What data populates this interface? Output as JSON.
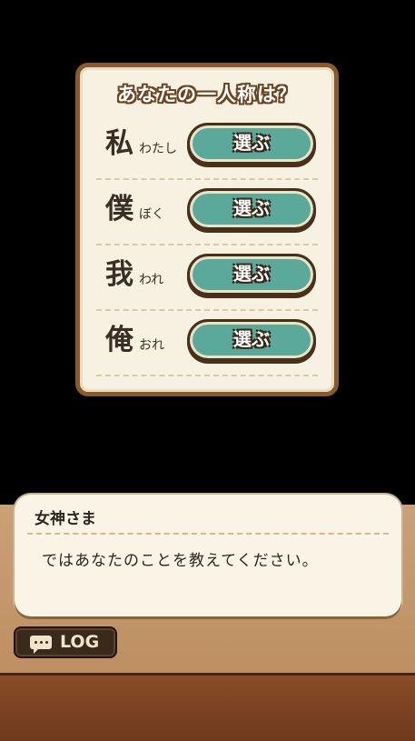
{
  "panel": {
    "title": "あなたの一人称は？",
    "choices": [
      {
        "kanji": "私",
        "reading": "わたし",
        "button": "選ぶ"
      },
      {
        "kanji": "僕",
        "reading": "ぼく",
        "button": "選ぶ"
      },
      {
        "kanji": "我",
        "reading": "われ",
        "button": "選ぶ"
      },
      {
        "kanji": "俺",
        "reading": "おれ",
        "button": "選ぶ"
      }
    ]
  },
  "dialog": {
    "speaker": "女神さま",
    "message": "ではあなたのことを教えてください。"
  },
  "log_button": {
    "label": "LOG",
    "icon": "chat-bubble-icon"
  },
  "colors": {
    "panel_bg": "#f7f1e1",
    "panel_border": "#8b5a2b",
    "button_teal": "#5aa99b",
    "wood": "#b8875a"
  }
}
